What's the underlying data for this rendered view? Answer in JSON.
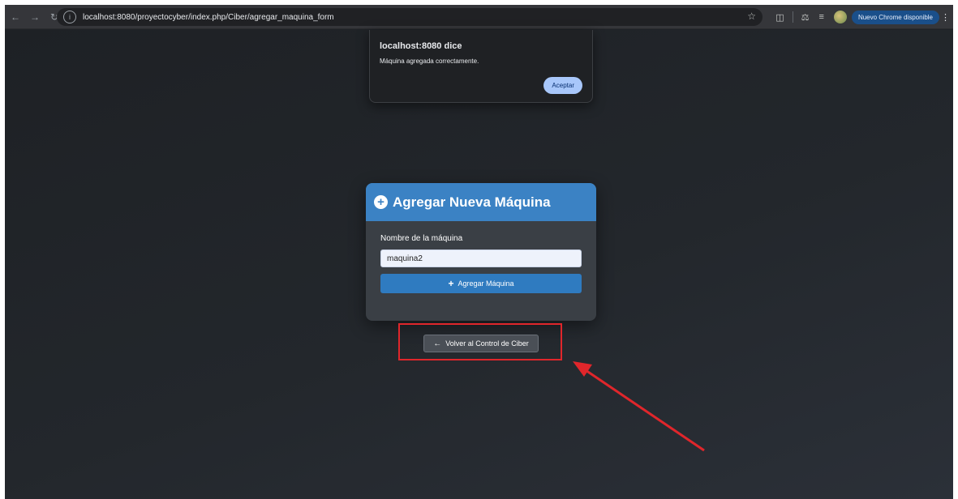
{
  "browser": {
    "url": "localhost:8080/proyectocyber/index.php/Ciber/agregar_maquina_form",
    "update_label": "Nuevo Chrome disponible",
    "nav_icons": [
      "back-icon",
      "forward-icon",
      "reload-icon"
    ]
  },
  "alert": {
    "title": "localhost:8080 dice",
    "message": "Máquina agregada correctamente.",
    "ok_label": "Aceptar"
  },
  "form": {
    "title": "Agregar Nueva Máquina",
    "field_label": "Nombre de la máquina",
    "field_value": "maquina2",
    "submit_label": "Agregar Máquina"
  },
  "back": {
    "label": "Volver al Control de Ciber"
  },
  "colors": {
    "header": "#3b82c4",
    "annotation": "#e0262b"
  }
}
